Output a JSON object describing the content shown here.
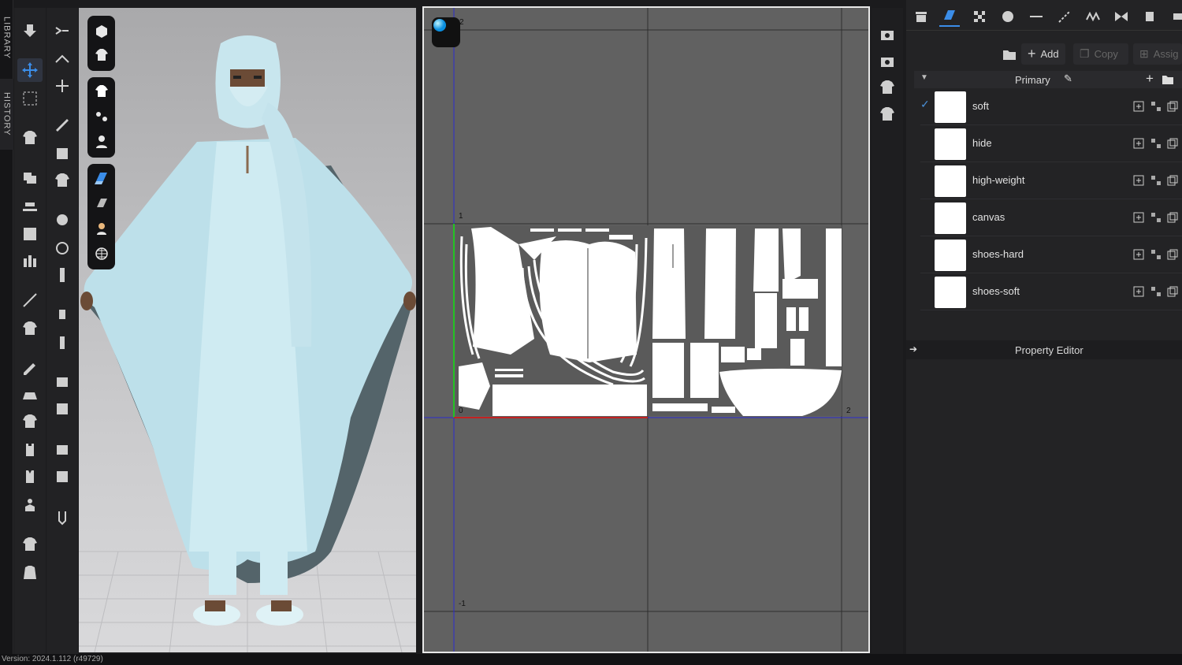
{
  "left_tabs": {
    "library": "LIBRARY",
    "history": "HISTORY"
  },
  "viewport": {
    "title": ""
  },
  "uv_editor": {
    "title": "",
    "labels": {
      "top_2": "2",
      "left_1": "1",
      "origin_0": "0",
      "right_2": "2",
      "bottom_minus1": "-1"
    }
  },
  "object_browser": {
    "title": "",
    "add_label": "Add",
    "copy_label": "Copy",
    "assign_label": "Assig",
    "primary_label": "Primary",
    "materials": [
      {
        "name": "soft",
        "checked": true
      },
      {
        "name": "hide",
        "checked": false
      },
      {
        "name": "high-weight",
        "checked": false
      },
      {
        "name": "canvas",
        "checked": false
      },
      {
        "name": "shoes-hard",
        "checked": false
      },
      {
        "name": "shoes-soft",
        "checked": false
      }
    ]
  },
  "property_editor": {
    "title": "Property Editor"
  },
  "status": {
    "version": "Version: 2024.1.112 (r49729)"
  },
  "colors": {
    "accent": "#4a8fd6",
    "uv_bg": "#616161",
    "garment": "#c8e8f0",
    "axis_green": "#22c222",
    "axis_red": "#c22222",
    "axis_blue": "#2a2ad0"
  }
}
